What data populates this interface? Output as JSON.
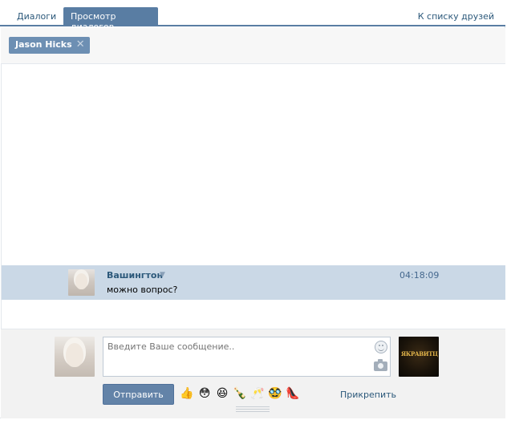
{
  "tabs": {
    "dialogs": "Диалоги",
    "view": "Просмотр диалогов",
    "friends_link": "К списку друзей"
  },
  "participants": {
    "chip_label": "Jason Hicks",
    "remove_glyph": "✕"
  },
  "message": {
    "author": "Вашингтон",
    "caret": "▼",
    "text": "можно вопрос?",
    "time": "04:18:09"
  },
  "compose": {
    "placeholder": "Введите Ваше сообщение..",
    "send_label": "Отправить",
    "attach_label": "Прикрепить",
    "emoji": [
      "👍",
      "😳",
      "😆",
      "🍾",
      "🥂",
      "🥸",
      "👠"
    ]
  },
  "colors": {
    "accent": "#597da3",
    "link": "#2b587a",
    "message_highlight": "#cad8e6"
  }
}
